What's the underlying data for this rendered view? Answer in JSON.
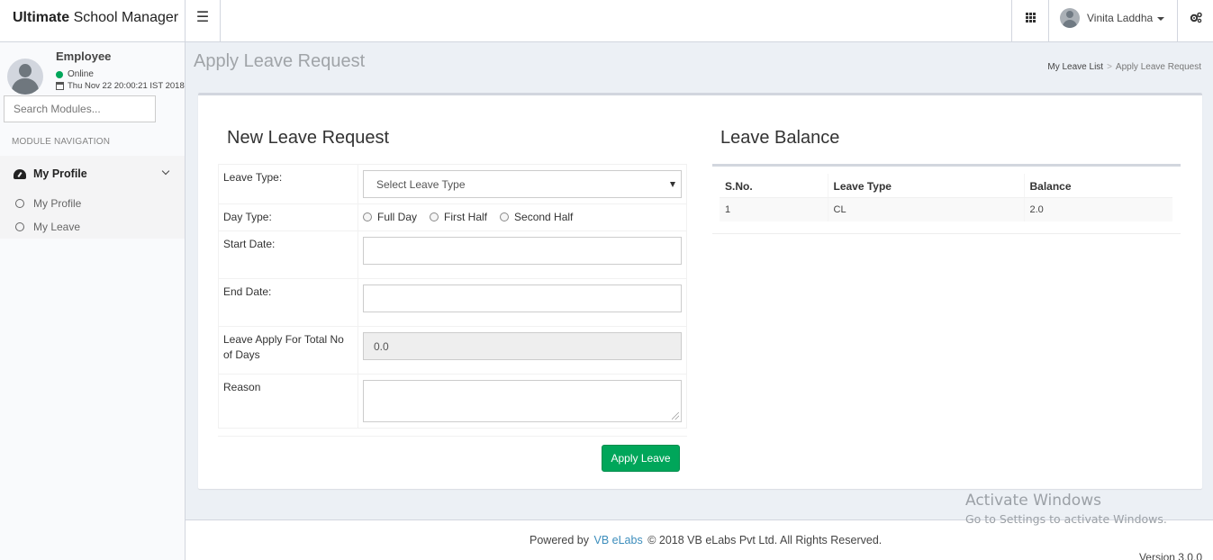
{
  "header": {
    "brand_bold": "Ultimate",
    "brand_rest": "School Manager",
    "user_name": "Vinita Laddha"
  },
  "sidebar": {
    "role": "Employee",
    "status": "Online",
    "datetime": "Thu Nov 22 20:00:21 IST 2018",
    "search_placeholder": "Search Modules...",
    "nav_heading": "MODULE NAVIGATION",
    "menu": {
      "label": "My Profile",
      "items": [
        {
          "label": "My Profile"
        },
        {
          "label": "My Leave"
        }
      ]
    }
  },
  "page": {
    "title": "Apply Leave Request",
    "breadcrumb": [
      "My Leave List",
      "Apply Leave Request"
    ]
  },
  "form": {
    "title": "New Leave Request",
    "leave_type_label": "Leave Type:",
    "leave_type_value": "Select Leave Type",
    "day_type_label": "Day Type:",
    "day_types": [
      "Full Day",
      "First Half",
      "Second Half"
    ],
    "start_date_label": "Start Date:",
    "start_date_value": "",
    "end_date_label": "End Date:",
    "end_date_value": "",
    "total_days_label": "Leave Apply For Total No of Days",
    "total_days_value": "0.0",
    "reason_label": "Reason",
    "reason_value": "",
    "submit_label": "Apply Leave"
  },
  "balance": {
    "title": "Leave Balance",
    "columns": [
      "S.No.",
      "Leave Type",
      "Balance"
    ],
    "rows": [
      [
        "1",
        "CL",
        "2.0"
      ]
    ]
  },
  "footer": {
    "powered_by": "Powered by",
    "link_text": "VB eLabs",
    "copyright": "© 2018 VB eLabs Pvt Ltd. All Rights Reserved.",
    "version": "Version 3.0.0"
  },
  "watermark": {
    "line1": "Activate Windows",
    "line2": "Go to Settings to activate Windows."
  },
  "colors": {
    "accent_green": "#00a65a",
    "link_blue": "#3c8dbc",
    "online_green": "#00a65a"
  }
}
